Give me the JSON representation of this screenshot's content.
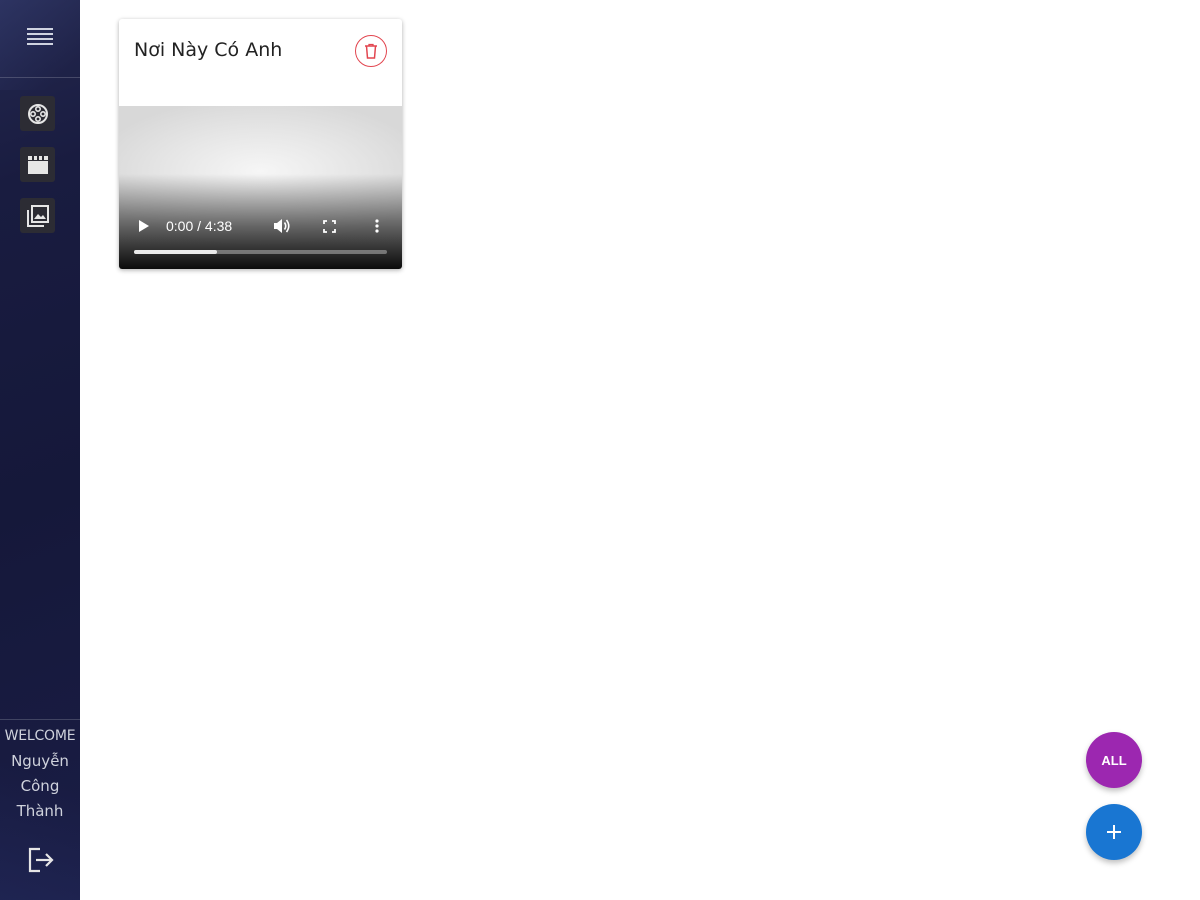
{
  "colors": {
    "sidebar_bg": "#191c40",
    "nav_item_bg": "#2c2c34",
    "delete_accent": "#e2454f",
    "fab_all": "#9c27b0",
    "fab_add": "#1976d2"
  },
  "sidebar": {
    "menu_icon": "hamburger-menu-icon",
    "nav_items": [
      {
        "name": "film-reel",
        "icon": "film-reel-icon"
      },
      {
        "name": "clapperboard",
        "icon": "clapperboard-icon"
      },
      {
        "name": "photo-library",
        "icon": "photo-library-icon"
      }
    ],
    "welcome_label": "WELCOME",
    "user_name_lines": [
      "Nguyễn",
      "Công",
      "Thành"
    ],
    "logout_icon": "logout-icon"
  },
  "card": {
    "title": "Nơi Này Có Anh",
    "delete_icon": "trash-icon",
    "video": {
      "time_display": "0:00 / 4:38",
      "progress": 0.33,
      "controls": [
        "play-icon",
        "volume-icon",
        "fullscreen-icon",
        "more-vert-icon"
      ]
    }
  },
  "fabs": {
    "all_label": "ALL",
    "add_label": "+"
  }
}
